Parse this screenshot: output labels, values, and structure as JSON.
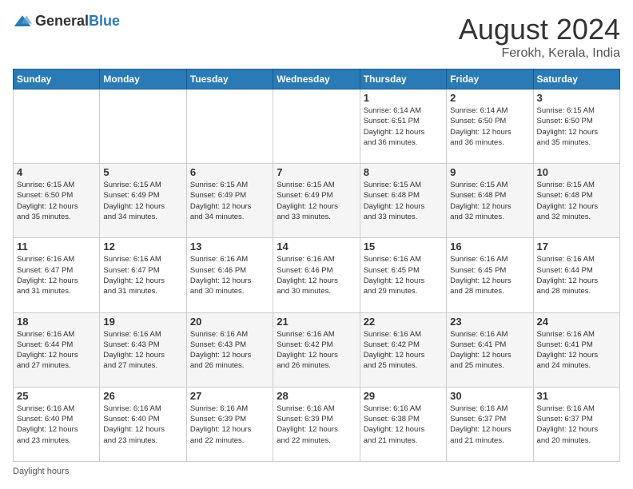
{
  "logo": {
    "text_general": "General",
    "text_blue": "Blue"
  },
  "header": {
    "month_year": "August 2024",
    "location": "Ferokh, Kerala, India"
  },
  "days_of_week": [
    "Sunday",
    "Monday",
    "Tuesday",
    "Wednesday",
    "Thursday",
    "Friday",
    "Saturday"
  ],
  "footer": {
    "daylight_label": "Daylight hours"
  },
  "weeks": [
    [
      {
        "day": "",
        "info": ""
      },
      {
        "day": "",
        "info": ""
      },
      {
        "day": "",
        "info": ""
      },
      {
        "day": "",
        "info": ""
      },
      {
        "day": "1",
        "info": "Sunrise: 6:14 AM\nSunset: 6:51 PM\nDaylight: 12 hours\nand 36 minutes."
      },
      {
        "day": "2",
        "info": "Sunrise: 6:14 AM\nSunset: 6:50 PM\nDaylight: 12 hours\nand 36 minutes."
      },
      {
        "day": "3",
        "info": "Sunrise: 6:15 AM\nSunset: 6:50 PM\nDaylight: 12 hours\nand 35 minutes."
      }
    ],
    [
      {
        "day": "4",
        "info": "Sunrise: 6:15 AM\nSunset: 6:50 PM\nDaylight: 12 hours\nand 35 minutes."
      },
      {
        "day": "5",
        "info": "Sunrise: 6:15 AM\nSunset: 6:49 PM\nDaylight: 12 hours\nand 34 minutes."
      },
      {
        "day": "6",
        "info": "Sunrise: 6:15 AM\nSunset: 6:49 PM\nDaylight: 12 hours\nand 34 minutes."
      },
      {
        "day": "7",
        "info": "Sunrise: 6:15 AM\nSunset: 6:49 PM\nDaylight: 12 hours\nand 33 minutes."
      },
      {
        "day": "8",
        "info": "Sunrise: 6:15 AM\nSunset: 6:48 PM\nDaylight: 12 hours\nand 33 minutes."
      },
      {
        "day": "9",
        "info": "Sunrise: 6:15 AM\nSunset: 6:48 PM\nDaylight: 12 hours\nand 32 minutes."
      },
      {
        "day": "10",
        "info": "Sunrise: 6:15 AM\nSunset: 6:48 PM\nDaylight: 12 hours\nand 32 minutes."
      }
    ],
    [
      {
        "day": "11",
        "info": "Sunrise: 6:16 AM\nSunset: 6:47 PM\nDaylight: 12 hours\nand 31 minutes."
      },
      {
        "day": "12",
        "info": "Sunrise: 6:16 AM\nSunset: 6:47 PM\nDaylight: 12 hours\nand 31 minutes."
      },
      {
        "day": "13",
        "info": "Sunrise: 6:16 AM\nSunset: 6:46 PM\nDaylight: 12 hours\nand 30 minutes."
      },
      {
        "day": "14",
        "info": "Sunrise: 6:16 AM\nSunset: 6:46 PM\nDaylight: 12 hours\nand 30 minutes."
      },
      {
        "day": "15",
        "info": "Sunrise: 6:16 AM\nSunset: 6:45 PM\nDaylight: 12 hours\nand 29 minutes."
      },
      {
        "day": "16",
        "info": "Sunrise: 6:16 AM\nSunset: 6:45 PM\nDaylight: 12 hours\nand 28 minutes."
      },
      {
        "day": "17",
        "info": "Sunrise: 6:16 AM\nSunset: 6:44 PM\nDaylight: 12 hours\nand 28 minutes."
      }
    ],
    [
      {
        "day": "18",
        "info": "Sunrise: 6:16 AM\nSunset: 6:44 PM\nDaylight: 12 hours\nand 27 minutes."
      },
      {
        "day": "19",
        "info": "Sunrise: 6:16 AM\nSunset: 6:43 PM\nDaylight: 12 hours\nand 27 minutes."
      },
      {
        "day": "20",
        "info": "Sunrise: 6:16 AM\nSunset: 6:43 PM\nDaylight: 12 hours\nand 26 minutes."
      },
      {
        "day": "21",
        "info": "Sunrise: 6:16 AM\nSunset: 6:42 PM\nDaylight: 12 hours\nand 26 minutes."
      },
      {
        "day": "22",
        "info": "Sunrise: 6:16 AM\nSunset: 6:42 PM\nDaylight: 12 hours\nand 25 minutes."
      },
      {
        "day": "23",
        "info": "Sunrise: 6:16 AM\nSunset: 6:41 PM\nDaylight: 12 hours\nand 25 minutes."
      },
      {
        "day": "24",
        "info": "Sunrise: 6:16 AM\nSunset: 6:41 PM\nDaylight: 12 hours\nand 24 minutes."
      }
    ],
    [
      {
        "day": "25",
        "info": "Sunrise: 6:16 AM\nSunset: 6:40 PM\nDaylight: 12 hours\nand 23 minutes."
      },
      {
        "day": "26",
        "info": "Sunrise: 6:16 AM\nSunset: 6:40 PM\nDaylight: 12 hours\nand 23 minutes."
      },
      {
        "day": "27",
        "info": "Sunrise: 6:16 AM\nSunset: 6:39 PM\nDaylight: 12 hours\nand 22 minutes."
      },
      {
        "day": "28",
        "info": "Sunrise: 6:16 AM\nSunset: 6:39 PM\nDaylight: 12 hours\nand 22 minutes."
      },
      {
        "day": "29",
        "info": "Sunrise: 6:16 AM\nSunset: 6:38 PM\nDaylight: 12 hours\nand 21 minutes."
      },
      {
        "day": "30",
        "info": "Sunrise: 6:16 AM\nSunset: 6:37 PM\nDaylight: 12 hours\nand 21 minutes."
      },
      {
        "day": "31",
        "info": "Sunrise: 6:16 AM\nSunset: 6:37 PM\nDaylight: 12 hours\nand 20 minutes."
      }
    ]
  ]
}
